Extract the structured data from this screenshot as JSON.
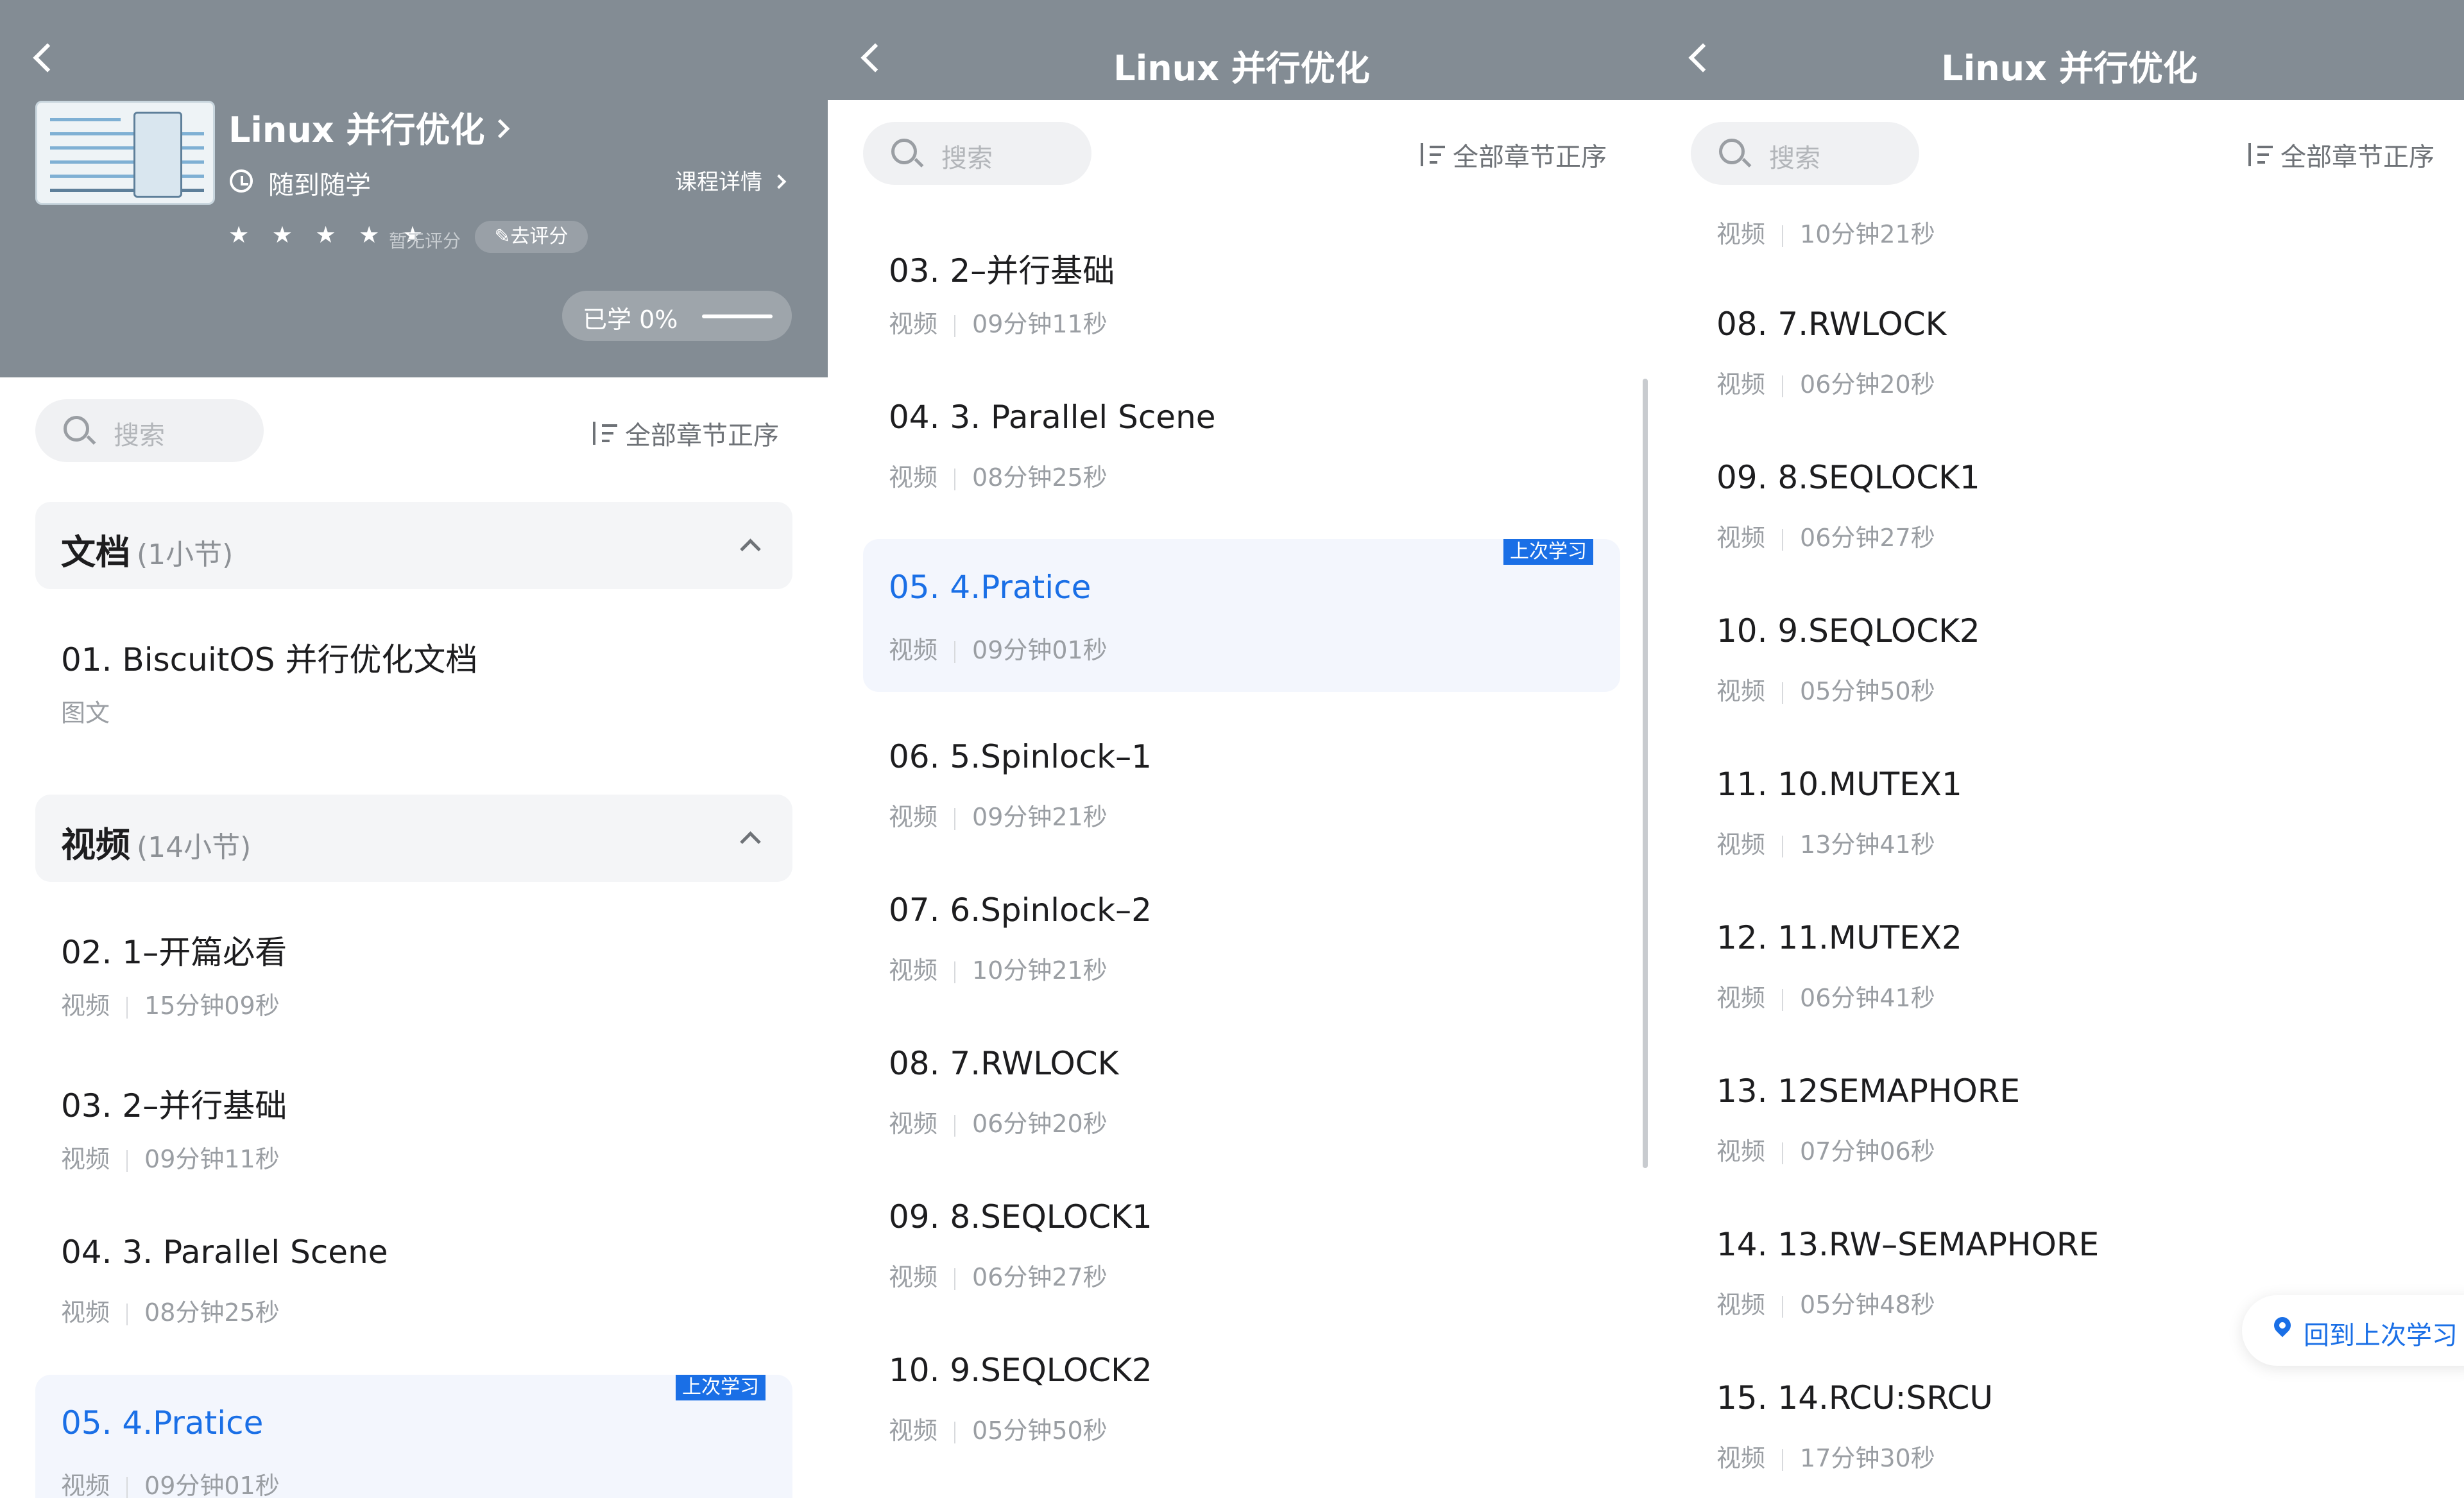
{
  "course": {
    "title": "Linux 并行优化",
    "study_mode": "随到随学",
    "detail_link": "课程详情",
    "stars": "★ ★ ★ ★ ★",
    "rating_text": "暂无评分",
    "rate_button": "✎去评分",
    "progress": "已学 0%",
    "progress_value": 0
  },
  "search": {
    "placeholder": "搜索"
  },
  "sort_label": "全部章节正序",
  "sections": {
    "doc": {
      "name": "文档",
      "count": "(1小节)"
    },
    "video": {
      "name": "视频",
      "count": "(14小节)"
    }
  },
  "last_studied_badge": "上次学习",
  "go_back_button": "回到上次学习",
  "lessons": [
    {
      "title": "01. BiscuitOS 并行优化文档",
      "type": "图文",
      "duration": ""
    },
    {
      "title": "02. 1–开篇必看",
      "type": "视频",
      "duration": "15分钟09秒"
    },
    {
      "title": "03. 2–并行基础",
      "type": "视频",
      "duration": "09分钟11秒"
    },
    {
      "title": "04. 3. Parallel Scene",
      "type": "视频",
      "duration": "08分钟25秒"
    },
    {
      "title": "05. 4.Pratice",
      "type": "视频",
      "duration": "09分钟01秒"
    },
    {
      "title": "06. 5.Spinlock–1",
      "type": "视频",
      "duration": "09分钟21秒"
    },
    {
      "title": "07. 6.Spinlock–2",
      "type": "视频",
      "duration": "10分钟21秒"
    },
    {
      "title": "08. 7.RWLOCK",
      "type": "视频",
      "duration": "06分钟20秒"
    },
    {
      "title": "09. 8.SEQLOCK1",
      "type": "视频",
      "duration": "06分钟27秒"
    },
    {
      "title": "10. 9.SEQLOCK2",
      "type": "视频",
      "duration": "05分钟50秒"
    },
    {
      "title": "11. 10.MUTEX1",
      "type": "视频",
      "duration": "13分钟41秒"
    },
    {
      "title": "12. 11.MUTEX2",
      "type": "视频",
      "duration": "06分钟41秒"
    },
    {
      "title": "13. 12SEMAPHORE",
      "type": "视频",
      "duration": "07分钟06秒"
    },
    {
      "title": "14. 13.RW–SEMAPHORE",
      "type": "视频",
      "duration": "05分钟48秒"
    },
    {
      "title": "15. 14.RCU:SRCU",
      "type": "视频",
      "duration": "17分钟30秒"
    }
  ]
}
